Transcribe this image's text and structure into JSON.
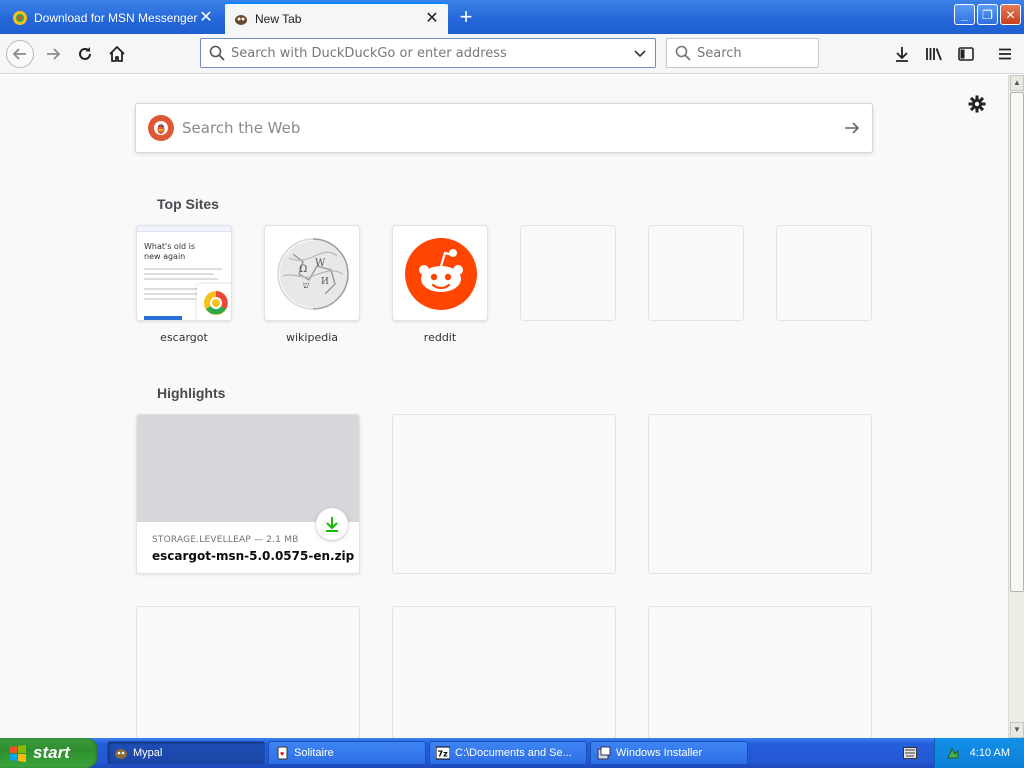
{
  "tabs": [
    {
      "title": "Download for MSN Messenger | Esc",
      "active": false
    },
    {
      "title": "New Tab",
      "active": true
    }
  ],
  "navbar": {
    "url_placeholder": "Search with DuckDuckGo or enter address",
    "search_placeholder": "Search"
  },
  "page": {
    "search_placeholder": "Search the Web",
    "top_sites_title": "Top Sites",
    "top_sites": [
      {
        "label": "escargot",
        "thumb_heading": "What's old is new again"
      },
      {
        "label": "wikipedia"
      },
      {
        "label": "reddit"
      },
      {
        "label": ""
      },
      {
        "label": ""
      },
      {
        "label": ""
      }
    ],
    "highlights_title": "Highlights",
    "highlight": {
      "source": "STORAGE.LEVELLEAP — 2.1 MB",
      "filename": "escargot-msn-5.0.0575-en.zip"
    }
  },
  "taskbar": {
    "start_label": "start",
    "tasks": [
      {
        "label": "Mypal",
        "active": true
      },
      {
        "label": "Solitaire",
        "active": false
      },
      {
        "label": "C:\\Documents and Se...",
        "active": false
      },
      {
        "label": "Windows Installer",
        "active": false
      }
    ],
    "clock": "4:10 AM"
  },
  "colors": {
    "accent": "#0a84ff",
    "reddit": "#ff4500",
    "ddg": "#de5833",
    "download_green": "#12bc00",
    "xp_blue": "#245edb"
  }
}
